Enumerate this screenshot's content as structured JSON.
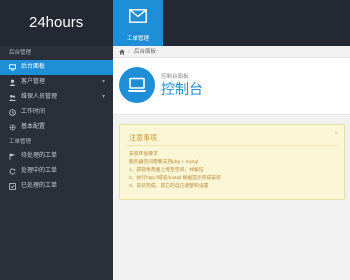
{
  "brand": {
    "title": "24hours"
  },
  "topnav": {
    "items": [
      {
        "label": "工单管理",
        "icon": "mail-icon"
      }
    ]
  },
  "sidebar": {
    "sections": [
      {
        "heading": "后台管理",
        "items": [
          {
            "label": "后台面板",
            "icon": "desktop-icon",
            "active": true
          },
          {
            "label": "客户管理",
            "icon": "user-icon",
            "caret": "▾"
          },
          {
            "label": "维保人员管理",
            "icon": "users-icon",
            "caret": "▾"
          },
          {
            "label": "工作时间",
            "icon": "clock-icon"
          },
          {
            "label": "基本配置",
            "icon": "gear-icon"
          }
        ]
      },
      {
        "heading": "工单管理",
        "items": [
          {
            "label": "待处理的工单",
            "icon": "flag-icon"
          },
          {
            "label": "处理中的工单",
            "icon": "refresh-icon"
          },
          {
            "label": "已处理的工单",
            "icon": "check-list-icon"
          }
        ]
      }
    ]
  },
  "breadcrumb": {
    "separator": "›",
    "current": "后台面板"
  },
  "page_header": {
    "pretitle": "控制台面板",
    "title": "控制台"
  },
  "notice": {
    "title": "注意事项",
    "close": "×",
    "lines": [
      "安装环境要求",
      "服务器空间需要支持php + mysql",
      "1、获取免费版上传至空间，并解压",
      "2、执行http://域名/install 根据提示完成安装",
      "3、安装完成，其它的自已调整和设置"
    ]
  },
  "colors": {
    "accent": "#1e8fd7",
    "topbar": "#232832",
    "sidebar": "#2b2f3a",
    "notice_text": "#b8893a"
  }
}
